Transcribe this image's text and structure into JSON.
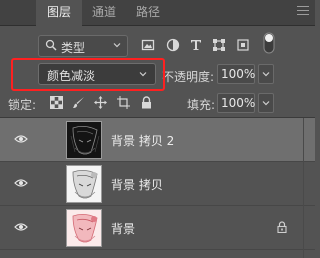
{
  "tabs": [
    {
      "label": "图层",
      "active": true
    },
    {
      "label": "通道",
      "active": false
    },
    {
      "label": "路径",
      "active": false
    }
  ],
  "filter": {
    "label": "类型"
  },
  "blend": {
    "mode": "颜色减淡"
  },
  "opacity": {
    "label": "不透明度:",
    "value": "100%"
  },
  "lock": {
    "label": "锁定:"
  },
  "fill": {
    "label": "填充:",
    "value": "100%"
  },
  "layers": [
    {
      "name": "背景 拷贝 2",
      "selected": true,
      "visible": true,
      "locked": false
    },
    {
      "name": "背景 拷贝",
      "selected": false,
      "visible": true,
      "locked": false
    },
    {
      "name": "背景",
      "selected": false,
      "visible": true,
      "locked": true
    }
  ],
  "colors": {
    "highlight": "#ff2020",
    "panel": "#535353",
    "selected_row": "#6f6f6f"
  },
  "icons": [
    "search-icon",
    "image-filter-icon",
    "adjustment-filter-icon",
    "type-filter-icon",
    "shape-filter-icon",
    "smart-object-filter-icon",
    "filter-toggle-icon",
    "lock-transparent-icon",
    "lock-paint-icon",
    "lock-move-icon",
    "lock-artboard-icon",
    "lock-all-icon",
    "eye-icon",
    "lock-icon",
    "panel-menu-icon"
  ]
}
